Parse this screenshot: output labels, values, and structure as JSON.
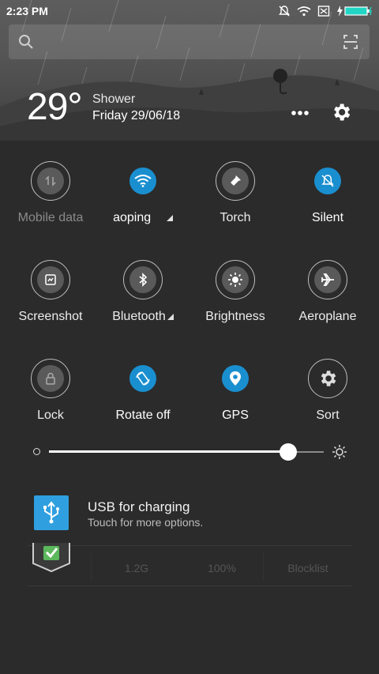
{
  "status_bar": {
    "time": "2:23 PM"
  },
  "search": {
    "placeholder": ""
  },
  "weather": {
    "temperature": "29°",
    "condition": "Shower",
    "date": "Friday 29/06/18"
  },
  "tiles": [
    {
      "label": "Mobile data",
      "icon": "mobile-data-icon"
    },
    {
      "label": "aoping",
      "icon": "wifi-icon"
    },
    {
      "label": "Torch",
      "icon": "torch-icon"
    },
    {
      "label": "Silent",
      "icon": "silent-icon"
    },
    {
      "label": "Screenshot",
      "icon": "screenshot-icon"
    },
    {
      "label": "Bluetooth",
      "icon": "bluetooth-icon"
    },
    {
      "label": "Brightness",
      "icon": "brightness-icon"
    },
    {
      "label": "Aeroplane",
      "icon": "aeroplane-icon"
    },
    {
      "label": "Lock",
      "icon": "lock-icon"
    },
    {
      "label": "Rotate off",
      "icon": "rotate-icon"
    },
    {
      "label": "GPS",
      "icon": "gps-icon"
    },
    {
      "label": "Sort",
      "icon": "gear-icon"
    }
  ],
  "brightness": {
    "level": 0.87
  },
  "notification": {
    "title": "USB for charging",
    "subtitle": "Touch for more options."
  },
  "behind_card": {
    "stats": [
      "1.2G",
      "100%",
      "Blocklist"
    ]
  },
  "colors": {
    "accent": "#1a8fd0",
    "usb_icon_bg": "#2f9fe0",
    "panel_bg": "#2b2b2b"
  }
}
